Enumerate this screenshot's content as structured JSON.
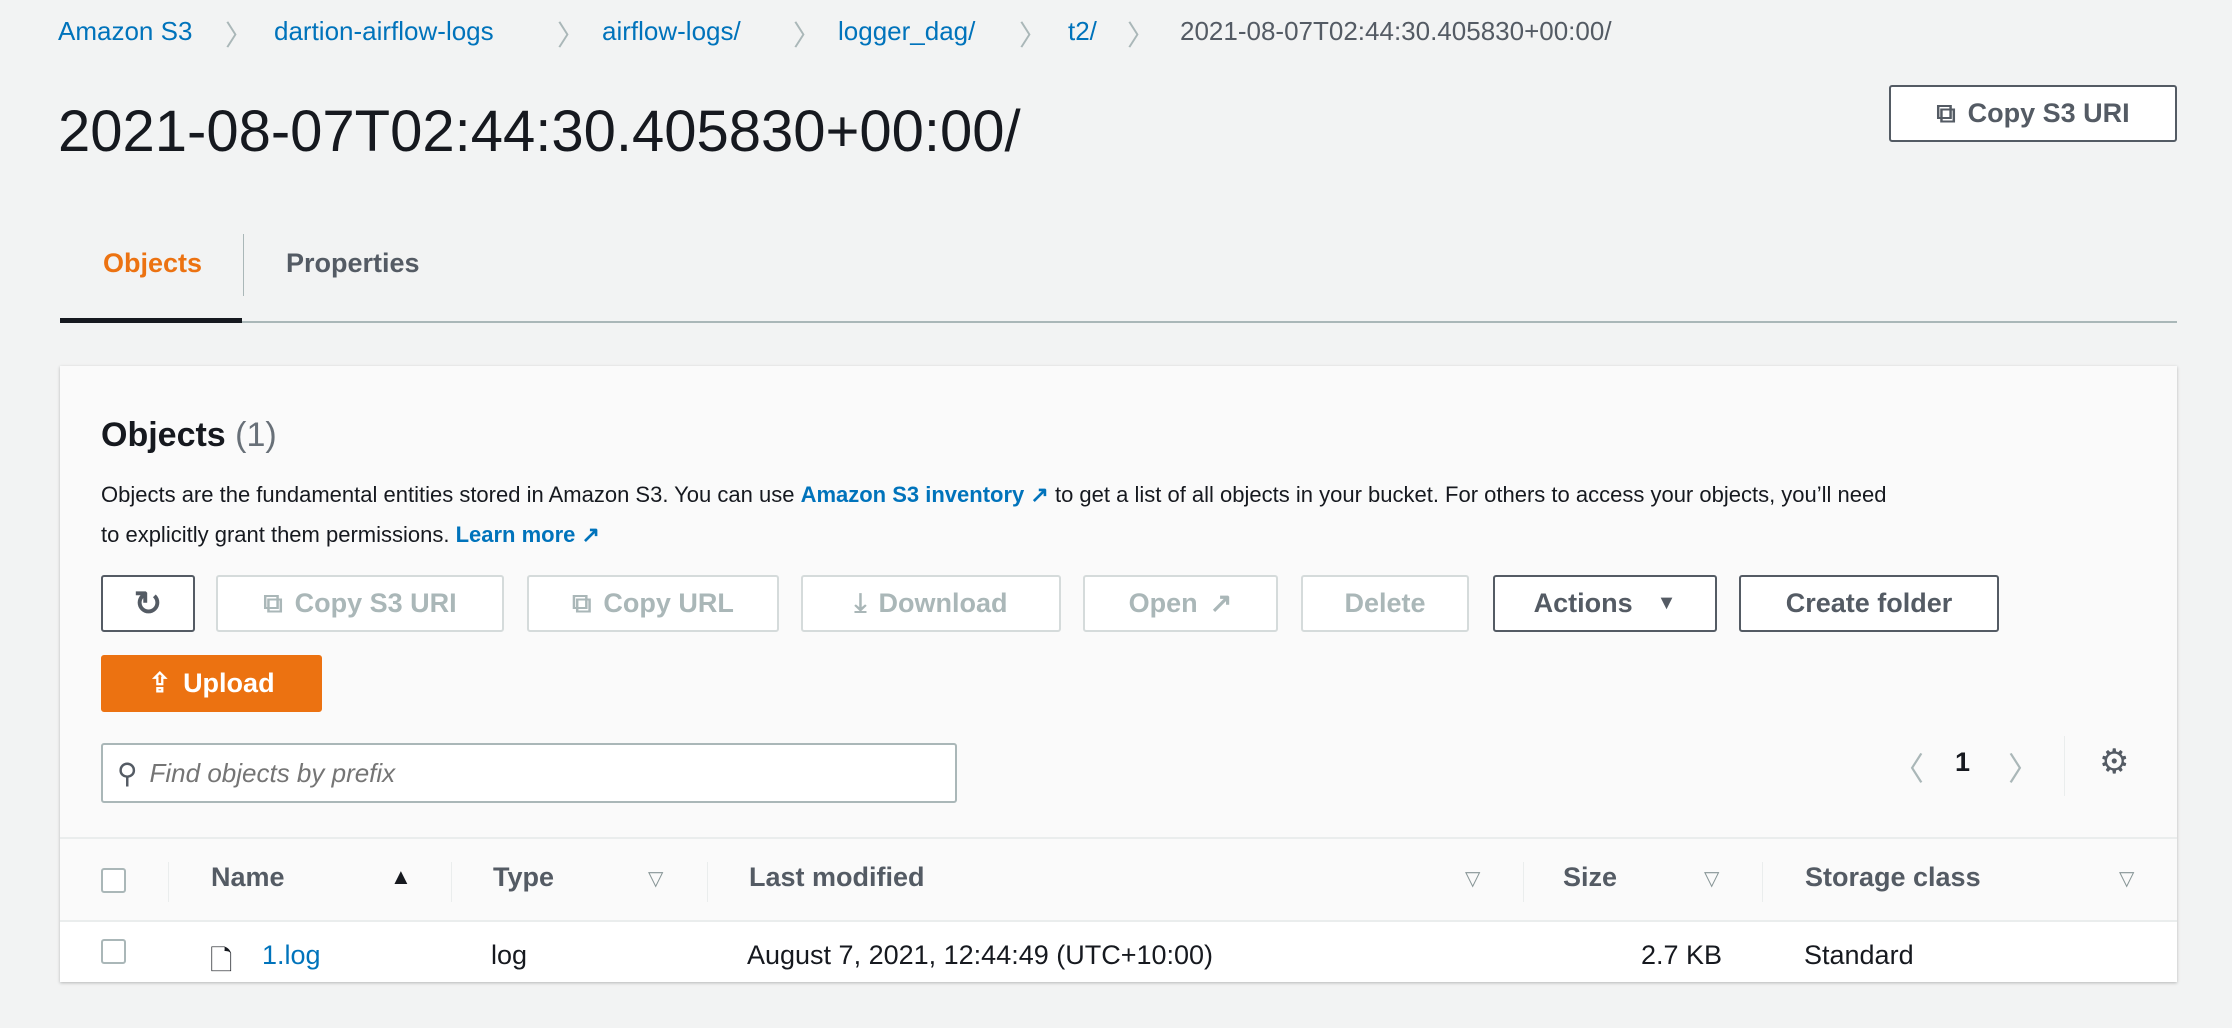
{
  "breadcrumb": [
    "Amazon S3",
    "dartion-airflow-logs",
    "airflow-logs/",
    "logger_dag/",
    "t2/",
    "2021-08-07T02:44:30.405830+00:00/"
  ],
  "title": "2021-08-07T02:44:30.405830+00:00/",
  "copy_s3_uri_header": "Copy S3 URI",
  "tabs": {
    "objects": "Objects",
    "properties": "Properties"
  },
  "panel": {
    "heading": "Objects",
    "count": "(1)",
    "desc_1a": "Objects are the fundamental entities stored in Amazon S3. You can use ",
    "desc_link1": "Amazon S3 inventory",
    "desc_1b": " to get a list of all objects in your bucket. For others to access your objects, you’ll need",
    "desc_2a": "to explicitly grant them permissions. ",
    "desc_link2": "Learn more",
    "buttons": {
      "copy_s3_uri": "Copy S3 URI",
      "copy_url": "Copy URL",
      "download": "Download",
      "open": "Open",
      "delete": "Delete",
      "actions": "Actions",
      "create_folder": "Create folder",
      "upload": "Upload"
    },
    "search_placeholder": "Find objects by prefix",
    "page": "1",
    "columns": [
      "Name",
      "Type",
      "Last modified",
      "Size",
      "Storage class"
    ],
    "rows": [
      {
        "name": "1.log",
        "type": "log",
        "last_modified": "August 7, 2021, 12:44:49 (UTC+10:00)",
        "size": "2.7 KB",
        "storage_class": "Standard"
      }
    ]
  },
  "colors": {
    "accent": "#ec7211",
    "link": "#0073bb"
  }
}
